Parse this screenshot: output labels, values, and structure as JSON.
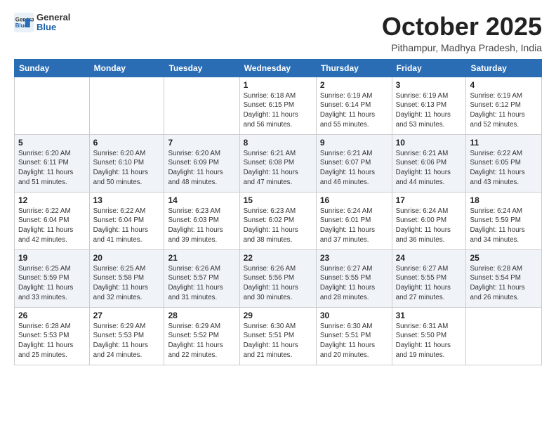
{
  "logo": {
    "line1": "General",
    "line2": "Blue"
  },
  "title": "October 2025",
  "subtitle": "Pithampur, Madhya Pradesh, India",
  "weekdays": [
    "Sunday",
    "Monday",
    "Tuesday",
    "Wednesday",
    "Thursday",
    "Friday",
    "Saturday"
  ],
  "weeks": [
    [
      {
        "day": "",
        "info": ""
      },
      {
        "day": "",
        "info": ""
      },
      {
        "day": "",
        "info": ""
      },
      {
        "day": "1",
        "info": "Sunrise: 6:18 AM\nSunset: 6:15 PM\nDaylight: 11 hours\nand 56 minutes."
      },
      {
        "day": "2",
        "info": "Sunrise: 6:19 AM\nSunset: 6:14 PM\nDaylight: 11 hours\nand 55 minutes."
      },
      {
        "day": "3",
        "info": "Sunrise: 6:19 AM\nSunset: 6:13 PM\nDaylight: 11 hours\nand 53 minutes."
      },
      {
        "day": "4",
        "info": "Sunrise: 6:19 AM\nSunset: 6:12 PM\nDaylight: 11 hours\nand 52 minutes."
      }
    ],
    [
      {
        "day": "5",
        "info": "Sunrise: 6:20 AM\nSunset: 6:11 PM\nDaylight: 11 hours\nand 51 minutes."
      },
      {
        "day": "6",
        "info": "Sunrise: 6:20 AM\nSunset: 6:10 PM\nDaylight: 11 hours\nand 50 minutes."
      },
      {
        "day": "7",
        "info": "Sunrise: 6:20 AM\nSunset: 6:09 PM\nDaylight: 11 hours\nand 48 minutes."
      },
      {
        "day": "8",
        "info": "Sunrise: 6:21 AM\nSunset: 6:08 PM\nDaylight: 11 hours\nand 47 minutes."
      },
      {
        "day": "9",
        "info": "Sunrise: 6:21 AM\nSunset: 6:07 PM\nDaylight: 11 hours\nand 46 minutes."
      },
      {
        "day": "10",
        "info": "Sunrise: 6:21 AM\nSunset: 6:06 PM\nDaylight: 11 hours\nand 44 minutes."
      },
      {
        "day": "11",
        "info": "Sunrise: 6:22 AM\nSunset: 6:05 PM\nDaylight: 11 hours\nand 43 minutes."
      }
    ],
    [
      {
        "day": "12",
        "info": "Sunrise: 6:22 AM\nSunset: 6:04 PM\nDaylight: 11 hours\nand 42 minutes."
      },
      {
        "day": "13",
        "info": "Sunrise: 6:22 AM\nSunset: 6:04 PM\nDaylight: 11 hours\nand 41 minutes."
      },
      {
        "day": "14",
        "info": "Sunrise: 6:23 AM\nSunset: 6:03 PM\nDaylight: 11 hours\nand 39 minutes."
      },
      {
        "day": "15",
        "info": "Sunrise: 6:23 AM\nSunset: 6:02 PM\nDaylight: 11 hours\nand 38 minutes."
      },
      {
        "day": "16",
        "info": "Sunrise: 6:24 AM\nSunset: 6:01 PM\nDaylight: 11 hours\nand 37 minutes."
      },
      {
        "day": "17",
        "info": "Sunrise: 6:24 AM\nSunset: 6:00 PM\nDaylight: 11 hours\nand 36 minutes."
      },
      {
        "day": "18",
        "info": "Sunrise: 6:24 AM\nSunset: 5:59 PM\nDaylight: 11 hours\nand 34 minutes."
      }
    ],
    [
      {
        "day": "19",
        "info": "Sunrise: 6:25 AM\nSunset: 5:59 PM\nDaylight: 11 hours\nand 33 minutes."
      },
      {
        "day": "20",
        "info": "Sunrise: 6:25 AM\nSunset: 5:58 PM\nDaylight: 11 hours\nand 32 minutes."
      },
      {
        "day": "21",
        "info": "Sunrise: 6:26 AM\nSunset: 5:57 PM\nDaylight: 11 hours\nand 31 minutes."
      },
      {
        "day": "22",
        "info": "Sunrise: 6:26 AM\nSunset: 5:56 PM\nDaylight: 11 hours\nand 30 minutes."
      },
      {
        "day": "23",
        "info": "Sunrise: 6:27 AM\nSunset: 5:55 PM\nDaylight: 11 hours\nand 28 minutes."
      },
      {
        "day": "24",
        "info": "Sunrise: 6:27 AM\nSunset: 5:55 PM\nDaylight: 11 hours\nand 27 minutes."
      },
      {
        "day": "25",
        "info": "Sunrise: 6:28 AM\nSunset: 5:54 PM\nDaylight: 11 hours\nand 26 minutes."
      }
    ],
    [
      {
        "day": "26",
        "info": "Sunrise: 6:28 AM\nSunset: 5:53 PM\nDaylight: 11 hours\nand 25 minutes."
      },
      {
        "day": "27",
        "info": "Sunrise: 6:29 AM\nSunset: 5:53 PM\nDaylight: 11 hours\nand 24 minutes."
      },
      {
        "day": "28",
        "info": "Sunrise: 6:29 AM\nSunset: 5:52 PM\nDaylight: 11 hours\nand 22 minutes."
      },
      {
        "day": "29",
        "info": "Sunrise: 6:30 AM\nSunset: 5:51 PM\nDaylight: 11 hours\nand 21 minutes."
      },
      {
        "day": "30",
        "info": "Sunrise: 6:30 AM\nSunset: 5:51 PM\nDaylight: 11 hours\nand 20 minutes."
      },
      {
        "day": "31",
        "info": "Sunrise: 6:31 AM\nSunset: 5:50 PM\nDaylight: 11 hours\nand 19 minutes."
      },
      {
        "day": "",
        "info": ""
      }
    ]
  ]
}
